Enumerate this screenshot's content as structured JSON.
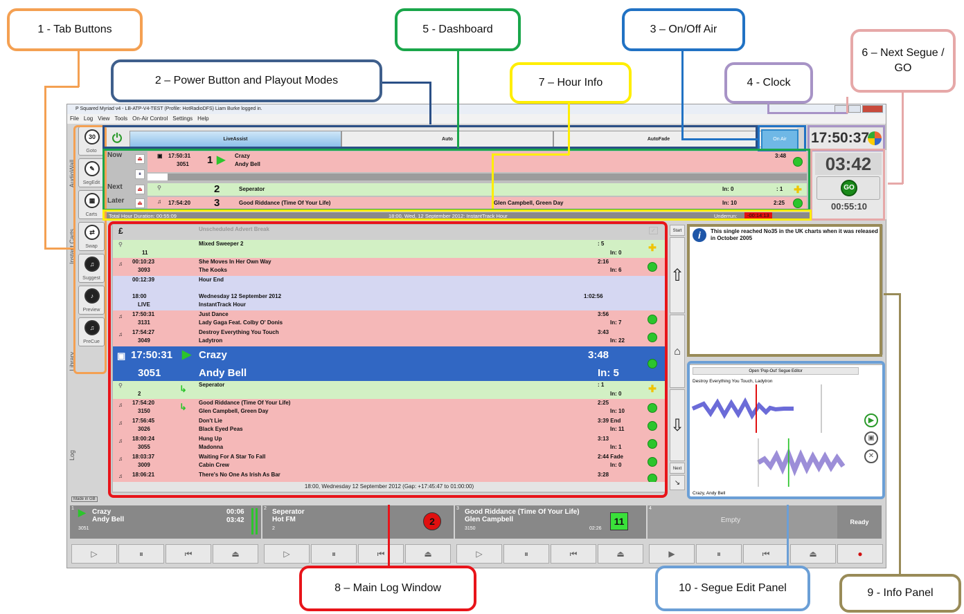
{
  "callouts": {
    "tab_buttons": "1 - Tab Buttons",
    "power_modes": "2 – Power Button and Playout Modes",
    "on_off_air": "3 – On/Off Air",
    "clock": "4 - Clock",
    "dashboard": "5 - Dashboard",
    "next_segue_go": "6 – Next Segue / GO",
    "hour_info": "7 – Hour Info",
    "main_log": "8 – Main Log Window",
    "info_panel": "9 - Info Panel",
    "segue_edit": "10 - Segue Edit Panel"
  },
  "callout_colors": {
    "orange": "#f4a052",
    "navy": "#3f5f8c",
    "green": "#1aa64a",
    "blue": "#2172c4",
    "lilac": "#a793c6",
    "pink": "#e6a8a8",
    "yellow": "#ffee00",
    "red": "#e8141a",
    "olive": "#998b58",
    "lightblue": "#6b9fd6"
  },
  "window": {
    "title": "P Squared Myriad v4 - LB-ATP-V4-TEST (Profile: HotRadioDFS) Liam Burke logged in.",
    "menu": [
      "File",
      "Log",
      "View",
      "Tools",
      "On-Air Control",
      "Settings",
      "Help"
    ]
  },
  "tabs": [
    {
      "icon": "30",
      "label": "Goto"
    },
    {
      "icon": "✎",
      "label": "SegEdit"
    },
    {
      "icon": "▦",
      "label": "Carts"
    },
    {
      "icon": "⇄",
      "label": "Swap"
    },
    {
      "icon": "♫",
      "label": "Suggest"
    },
    {
      "icon": "♪",
      "label": "Preview"
    },
    {
      "icon": "♫",
      "label": "PreCue"
    }
  ],
  "side_labels": {
    "audiowall": "AudioWall",
    "instant_carts": "Instant Carts",
    "library": "Library",
    "log": "Log",
    "made_in": "Made in GB"
  },
  "modes": {
    "liveassist": "LiveAssist",
    "auto": "Auto",
    "autofade": "AutoFade",
    "on_air": "On Air"
  },
  "clock": "17:50:37",
  "dashboard": {
    "now": {
      "label": "Now",
      "time": "17:50:31",
      "id": "3051",
      "slot": "1",
      "title": "Crazy",
      "artist": "Andy Bell",
      "duration": "3:48"
    },
    "next": {
      "label": "Next",
      "slot": "2",
      "title": "Seperator",
      "intro": "In: 0",
      "duration": ": 1"
    },
    "later": {
      "label": "Later",
      "time": "17:54:20",
      "slot": "3",
      "title": "Good Riddance (Time Of Your Life)",
      "artist": "Glen Campbell, Green Day",
      "intro": "In: 10",
      "duration": "2:25"
    }
  },
  "countdown": "03:42",
  "go_label": "GO",
  "segue_time": "00:55:10",
  "hour_bar": {
    "left": "Total Hour Duration:  00:55:09",
    "center": "18:00, Wed, 12 September 2012: InstantTrack Hour",
    "underrun_label": "Underrun:",
    "underrun_value": "-00:14:13"
  },
  "log": [
    {
      "kind": "grey",
      "time": "",
      "id": "",
      "title": "Unscheduled Advert Break",
      "artist": "",
      "dur": "",
      "intro": ""
    },
    {
      "kind": "green",
      "time": "",
      "id": "11",
      "title": "Mixed Sweeper 2",
      "artist": "",
      "dur": ": 5",
      "intro": "In:  0"
    },
    {
      "kind": "pink",
      "time": "00:10:23",
      "id": "3093",
      "title": "She Moves In Her Own Way",
      "artist": "The Kooks",
      "dur": "2:16",
      "intro": "In:  6"
    },
    {
      "kind": "lavender",
      "time": "00:12:39",
      "id": "",
      "title": "Hour End",
      "artist": "",
      "dur": "",
      "intro": ""
    },
    {
      "kind": "lavender",
      "time": "18:00",
      "id": "LIVE",
      "title": "Wednesday 12 September 2012",
      "artist": "InstantTrack Hour",
      "dur": "1:02:56",
      "intro": ""
    },
    {
      "kind": "pink",
      "time": "17:50:31",
      "id": "3131",
      "title": "Just Dance",
      "artist": "Lady Gaga Feat. Colby O' Donis",
      "dur": "3:56",
      "intro": "In:  7"
    },
    {
      "kind": "pink",
      "time": "17:54:27",
      "id": "3049",
      "title": "Destroy Everything You Touch",
      "artist": "Ladytron",
      "dur": "3:43",
      "intro": "In: 22"
    },
    {
      "kind": "now",
      "time": "17:50:31",
      "id": "3051",
      "title": "Crazy",
      "artist": "Andy Bell",
      "dur": "3:48",
      "intro": "In:  5"
    },
    {
      "kind": "green",
      "time": "",
      "id": "2",
      "title": "Seperator",
      "artist": "",
      "dur": ": 1",
      "intro": "In:  0"
    },
    {
      "kind": "pink",
      "time": "17:54:20",
      "id": "3150",
      "title": "Good Riddance (Time Of Your Life)",
      "artist": "Glen Campbell, Green Day",
      "dur": "2:25",
      "intro": "In: 10"
    },
    {
      "kind": "pink",
      "time": "17:56:45",
      "id": "3026",
      "title": "Don't Lie",
      "artist": "Black Eyed Peas",
      "dur": "3:39 End",
      "intro": "In: 11"
    },
    {
      "kind": "pink",
      "time": "18:00:24",
      "id": "3055",
      "title": "Hung Up",
      "artist": "Madonna",
      "dur": "3:13",
      "intro": "In:  1"
    },
    {
      "kind": "pink",
      "time": "18:03:37",
      "id": "3009",
      "title": "Waiting For A Star To Fall",
      "artist": "Cabin Crew",
      "dur": "2:44 Fade",
      "intro": "In:  0"
    },
    {
      "kind": "pink",
      "time": "18:06:21",
      "id": "",
      "title": "There's No One As Irish As Bar",
      "artist": "",
      "dur": "3:28",
      "intro": ""
    }
  ],
  "log_footer": "18:00, Wednesday 12 September 2012 (Gap: +17:45:47 to 01:00:00)",
  "nav": {
    "start": "Start",
    "next": "Next"
  },
  "info_text": "This single reached No35 in the UK charts when it was released in October 2005",
  "segue_editor": {
    "open_btn": "Open 'Pop-Out' Segue Editor",
    "track_a": "Destroy Everything You Touch, Ladytron",
    "track_b": "Crazy, Andy Bell"
  },
  "players": [
    {
      "num": "1",
      "title": "Crazy",
      "artist": "Andy Bell",
      "id": "3051",
      "elapsed": "00:06",
      "remain": "03:42",
      "badge": ""
    },
    {
      "num": "2",
      "title": "Seperator",
      "artist": "Hot FM",
      "id": "2",
      "elapsed": "",
      "remain": "",
      "badge": "2"
    },
    {
      "num": "3",
      "title": "Good Riddance (Time Of Your Life)",
      "artist": "Glen Campbell",
      "id": "3150",
      "elapsed": "",
      "remain": "02:26",
      "badge": "11"
    },
    {
      "num": "4",
      "title": "Empty",
      "artist": "",
      "id": "",
      "elapsed": "",
      "remain": "",
      "badge": ""
    }
  ],
  "ready": "Ready"
}
